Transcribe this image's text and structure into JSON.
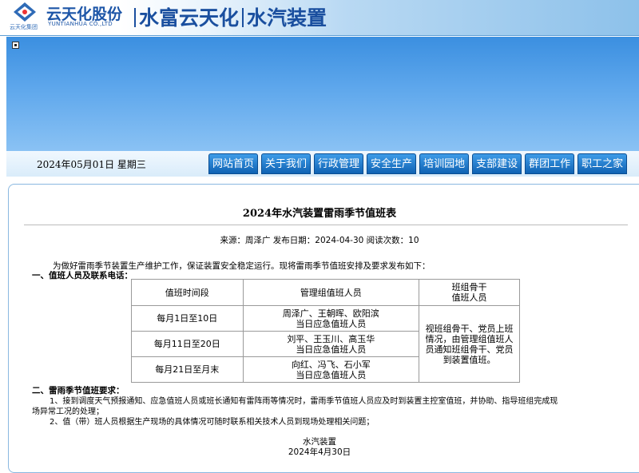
{
  "header": {
    "logo_small_text": "云天化集团",
    "brand_cn": "云天化股份",
    "brand_en": "YUNTIANHUA CO.,LTD",
    "title_part1": "水富云天化",
    "title_part2": "水汽装置"
  },
  "date_text": "2024年05月01日  星期三",
  "nav": [
    "网站首页",
    "关于我们",
    "行政管理",
    "安全生产",
    "培训园地",
    "支部建设",
    "群团工作",
    "职工之家"
  ],
  "article": {
    "title": "2024年水汽装置雷雨季节值班表",
    "meta": "来源：周泽广  发布日期：2024-04-30  阅读次数：10",
    "intro": "为做好雷雨季节装置生产维护工作，保证装置安全稳定运行。现将雷雨季节值班安排及要求发布如下：",
    "section1": "一、值班人员及联系电话：",
    "table": {
      "headers": [
        "值班时间段",
        "管理组值班人员",
        "班组骨干\n值班人员"
      ],
      "rows": [
        {
          "period": "每月1日至10日",
          "staff_line1": "周泽广、王朝晖、欧阳滨",
          "staff_line2": "当日应急值班人员"
        },
        {
          "period": "每月11日至20日",
          "staff_line1": "刘平、王玉川、高玉华",
          "staff_line2": "当日应急值班人员"
        },
        {
          "period": "每月21日至月末",
          "staff_line1": "向红、冯飞、石小军",
          "staff_line2": "当日应急值班人员"
        }
      ],
      "note": "视班组骨干、党员上班情况，由管理组值班人员通知班组骨干、党员到装置值班。"
    },
    "section2": "二、雷雨季节值班要求：",
    "req1_line1": "1、接到调度天气预报通知、应急值班人员或班长通知有雷阵雨等情况时，雷雨季节值班人员应及时到装置主控室值班，并协助、指导班组完成现",
    "req1_line2": "场异常工况的处理；",
    "req2": "2、值（带）班人员根据生产现场的具体情况可随时联系相关技术人员到现场处理相关问题；",
    "sign_org": "水汽装置",
    "sign_date": "2024年4月30日"
  },
  "colors": {
    "brand_blue": "#1a4f9f",
    "nav_blue": "#0f62b3",
    "banner_blue": "#5ea7ec"
  }
}
